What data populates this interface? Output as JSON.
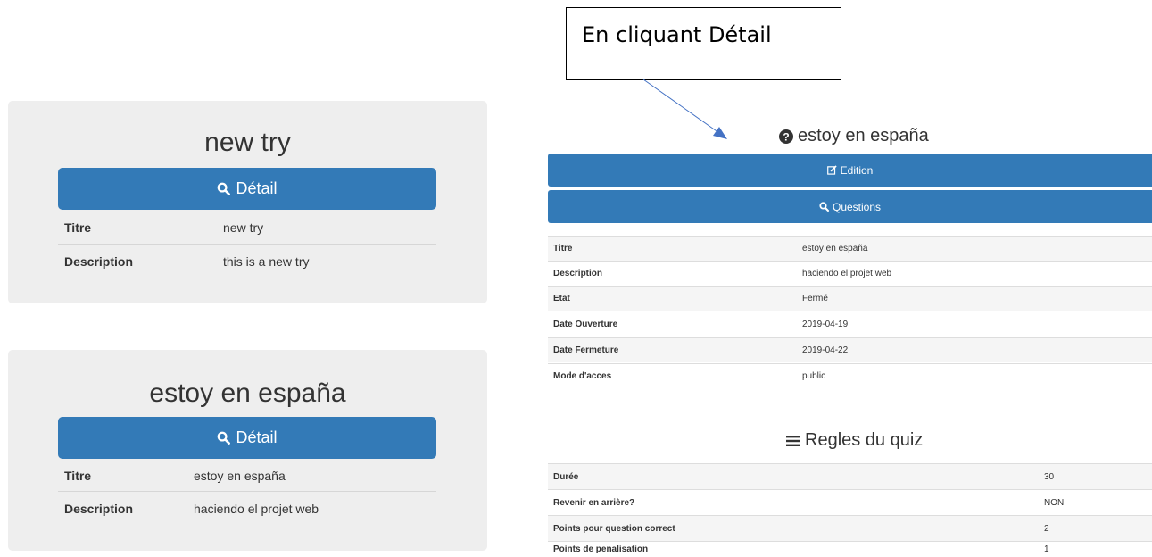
{
  "cards": [
    {
      "title": "new try",
      "button_label": "Détail",
      "rows": [
        {
          "label": "Titre",
          "value": "new try"
        },
        {
          "label": "Description",
          "value": "this is a new try"
        }
      ]
    },
    {
      "title": "estoy en españa",
      "button_label": "Détail",
      "rows": [
        {
          "label": "Titre",
          "value": "estoy en españa"
        },
        {
          "label": "Description",
          "value": "haciendo el projet web"
        }
      ]
    }
  ],
  "callout": {
    "text": "En cliquant Détail"
  },
  "quiz": {
    "title": "estoy en españa",
    "edit_label": "Edition",
    "questions_label": "Questions",
    "info": [
      {
        "label": "Titre",
        "value": "estoy en españa"
      },
      {
        "label": "Description",
        "value": "haciendo el projet web"
      },
      {
        "label": "Etat",
        "value": "Fermé"
      },
      {
        "label": "Date Ouverture",
        "value": "2019-04-19"
      },
      {
        "label": "Date Fermeture",
        "value": "2019-04-22"
      },
      {
        "label": "Mode d'acces",
        "value": "public"
      }
    ]
  },
  "rules": {
    "title": "Regles du quiz",
    "items": [
      {
        "label": "Durée",
        "value": "30"
      },
      {
        "label": "Revenir en arrière?",
        "value": "NON"
      },
      {
        "label": "Points pour question correct",
        "value": "2"
      },
      {
        "label": "Points de penalisation",
        "value": "1"
      }
    ]
  },
  "colors": {
    "primary": "#337ab7",
    "card_bg": "#eeeeee"
  }
}
